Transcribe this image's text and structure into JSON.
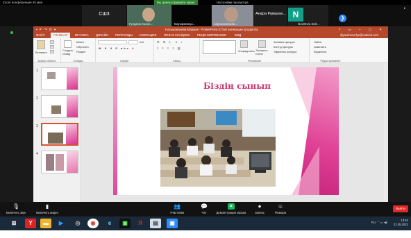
{
  "zoom_window": {
    "title": "Zoom Конференция 45 мин",
    "share_banner": "Вы демонстрируете экран",
    "share_stop": "Настройки просмотра"
  },
  "participants": [
    {
      "name": "СШ3",
      "has_video": false
    },
    {
      "name": "Гулдана Калас...",
      "has_video": true
    },
    {
      "name": "Бауыржанқы...",
      "has_video": true
    },
    {
      "name": "наурызжанова...",
      "has_video": true
    },
    {
      "name": "Анара Рамазан...",
      "has_video": false
    },
    {
      "name": "NAZGUL Seit...",
      "has_video": false,
      "initial": "N"
    }
  ],
  "powerpoint": {
    "quick_access": "▪ ↶ ↷ ⊡ ▾",
    "title": "Насыканакова Маржан - PowerPoint (Сбой активации продукта)",
    "window_controls": "? ▭ – ▢ ✕",
    "user": "dlyandnoverlye@outlook.com",
    "tabs": [
      {
        "label": "ФАЙЛ",
        "active": false,
        "file": true
      },
      {
        "label": "ГЛАВНАЯ",
        "active": true
      },
      {
        "label": "ВСТАВКА"
      },
      {
        "label": "ДИЗАЙН"
      },
      {
        "label": "ПЕРЕХОДЫ"
      },
      {
        "label": "АНИМАЦИЯ"
      },
      {
        "label": "ПОКАЗ СЛАЙДОВ"
      },
      {
        "label": "РЕЦЕНЗИРОВАНИЕ"
      },
      {
        "label": "ВИД"
      }
    ],
    "ribbon": {
      "clipboard": {
        "label": "Буфер обмена",
        "paste": "Вставить"
      },
      "slides": {
        "label": "Слайды",
        "create": "Создать слайд",
        "layout": "Макет",
        "reset": "Сбросить",
        "section": "Раздел"
      },
      "font": {
        "label": "Шрифт"
      },
      "paragraph": {
        "label": "Абзац"
      },
      "drawing": {
        "label": "Рисование",
        "arrange": "Упорядочить",
        "quick_styles": "Экспресс-стили",
        "fill": "Заливка фигуры",
        "outline": "Контур фигуры",
        "effects": "Эффекты фигуры"
      },
      "editing": {
        "label": "Редактирование",
        "find": "Найти",
        "replace": "Заменить",
        "select": "Выделить"
      }
    },
    "slides": [
      {
        "num": "1",
        "selected": false
      },
      {
        "num": "2",
        "selected": false
      },
      {
        "num": "3",
        "selected": true
      },
      {
        "num": "4",
        "selected": false
      }
    ],
    "current_slide": {
      "title": "Біздің сынып"
    }
  },
  "zoom_toolbar": {
    "mute": "Включить звук",
    "video": "Включить видео",
    "participants": "Участники",
    "participants_count": "7",
    "chat": "Чат",
    "share": "Демонстрация экрана",
    "record": "Запись",
    "reactions": "Реакции",
    "leave": "Выйти"
  },
  "taskbar": {
    "lang": "RU",
    "time": "13:51",
    "date": "21.05.2021"
  }
}
